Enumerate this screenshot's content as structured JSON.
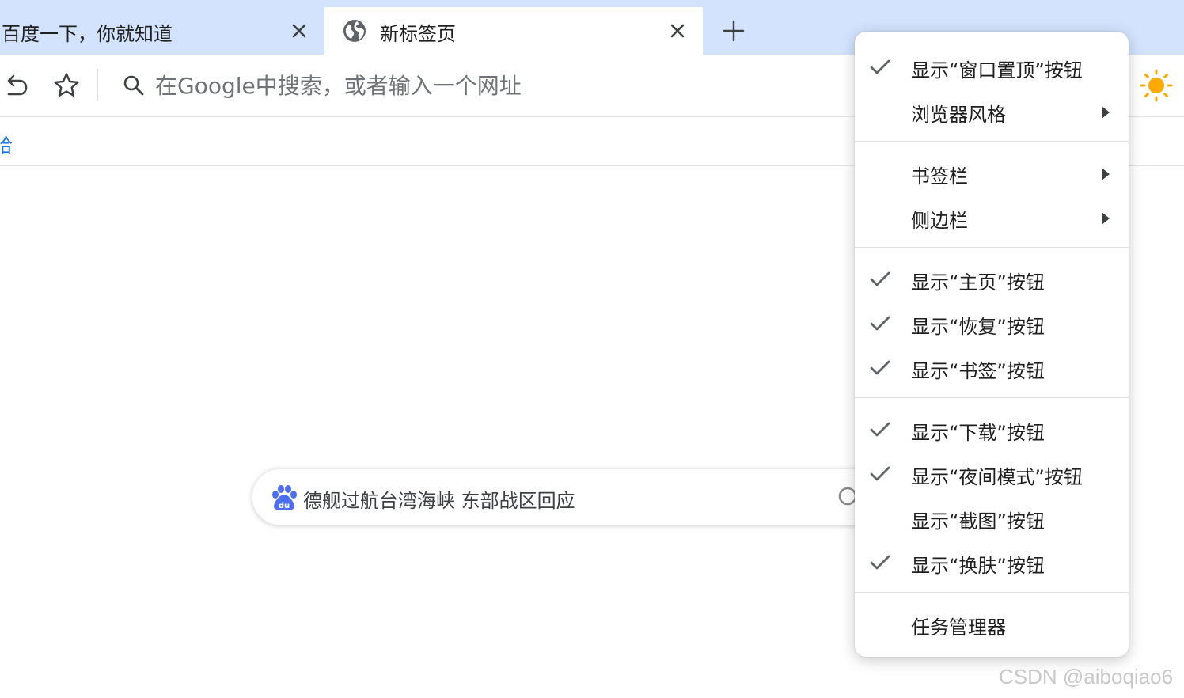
{
  "tabs": [
    {
      "title": "百度一下，你就知道",
      "active": false
    },
    {
      "title": "新标签页",
      "active": true
    }
  ],
  "icons": {
    "tab_close": "close-icon",
    "tab_favicon": "globe-icon",
    "new_tab": "plus-icon",
    "undo": "undo-icon",
    "bookmark": "star-icon",
    "search": "search-icon",
    "theme": "sun-icon",
    "check": "check-icon",
    "submenu": "triangle-right-icon"
  },
  "toolbar": {
    "omnibox_placeholder": "在Google中搜索，或者输入一个网址"
  },
  "bookmarks_bar": {
    "items": [
      "哈"
    ]
  },
  "ntp": {
    "search_query": "德舰过航台湾海峡 东部战区回应",
    "search_engine": "du"
  },
  "menu": {
    "items": [
      {
        "label": "显示“窗口置顶”按钮",
        "checked": true,
        "submenu": false
      },
      {
        "label": "浏览器风格",
        "checked": false,
        "submenu": true
      },
      {
        "label": "书签栏",
        "checked": false,
        "submenu": true
      },
      {
        "label": "侧边栏",
        "checked": false,
        "submenu": true
      },
      {
        "label": "显示“主页”按钮",
        "checked": true,
        "submenu": false
      },
      {
        "label": "显示“恢复”按钮",
        "checked": true,
        "submenu": false
      },
      {
        "label": "显示“书签”按钮",
        "checked": true,
        "submenu": false
      },
      {
        "label": "显示“下载”按钮",
        "checked": true,
        "submenu": false
      },
      {
        "label": "显示“夜间模式”按钮",
        "checked": true,
        "submenu": false
      },
      {
        "label": "显示“截图”按钮",
        "checked": false,
        "submenu": false
      },
      {
        "label": "显示“换肤”按钮",
        "checked": true,
        "submenu": false
      },
      {
        "label": "任务管理器",
        "checked": false,
        "submenu": false
      }
    ]
  },
  "watermark": "CSDN @aiboqiao6",
  "colors": {
    "tabstrip": "#d3e3fd",
    "accent": "#1a73e8",
    "sun": "#f9ab00"
  }
}
